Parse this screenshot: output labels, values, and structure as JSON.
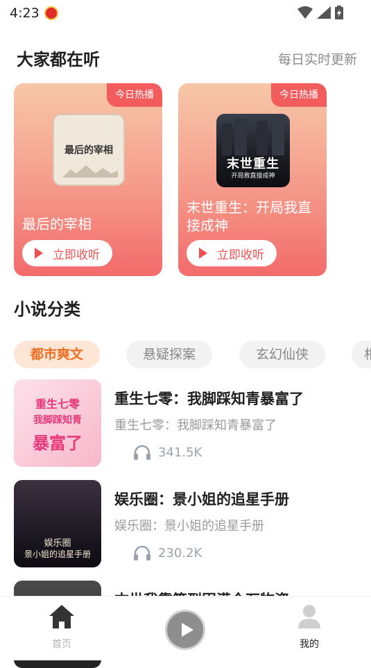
{
  "status_bar": {
    "time": "4:23"
  },
  "hot_section": {
    "title": "大家都在听",
    "subtitle": "每日实时更新",
    "cards": [
      {
        "badge": "今日热播",
        "cover_text": "最后的宰相",
        "title": "最后的宰相",
        "button_label": "立即收听"
      },
      {
        "badge": "今日热播",
        "cover_text": "末世重生",
        "cover_subtext": "开局救直接成神",
        "title": "末世重生：开局我直接成神",
        "button_label": "立即收听"
      }
    ]
  },
  "category_section": {
    "title": "小说分类",
    "chips": [
      "都市爽文",
      "悬疑探案",
      "玄幻仙侠",
      "相"
    ],
    "active_chip": "都市爽文"
  },
  "books": [
    {
      "cover_lines": [
        "重生七零",
        "我脚踩知青",
        "暴富了"
      ],
      "title": "重生七零：我脚踩知青暴富了",
      "desc": "重生七零：我脚踩知青暴富了",
      "plays": "341.5K"
    },
    {
      "cover_lines": [
        "娱乐圈",
        "景小姐的追星手册"
      ],
      "title": "娱乐圈：景小姐的追星手册",
      "desc": "娱乐圈：景小姐的追星手册",
      "plays": "230.2K"
    },
    {
      "title": "末世我靠签到囤满仓万物资"
    }
  ],
  "tabbar": {
    "home_label": "首页",
    "me_label": "我的"
  },
  "colors": {
    "accent": "#f05050",
    "active_chip_text": "#f06d1f",
    "active_chip_bg": "#fde6d5"
  }
}
